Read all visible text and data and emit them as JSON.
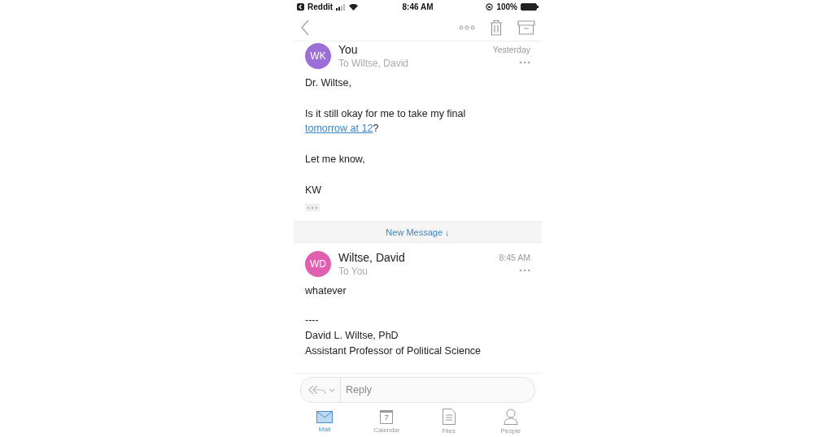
{
  "status_bar": {
    "back_app": "Reddit",
    "time": "8:46 AM",
    "battery": "100%"
  },
  "messages": [
    {
      "initials": "WK",
      "color": "#9b6fd6",
      "sender": "You",
      "recipients": "To Wiltse, David",
      "time": "Yesterday",
      "collapsed_quote": true,
      "body": [
        [
          {
            "text": "Dr. Wiltse,"
          }
        ],
        [
          {
            "text": "Is it still okay for me to take my final "
          },
          {
            "text": "tomorrow at 12",
            "kind": "link"
          },
          {
            "text": "?"
          }
        ],
        [
          {
            "text": "Let me know,"
          }
        ],
        [
          {
            "text": "KW"
          }
        ]
      ]
    },
    {
      "initials": "WD",
      "color": "#e25fb0",
      "sender": "Wiltse, David",
      "recipients": "To You",
      "time": "8:45 AM",
      "body": [
        [
          {
            "text": "whatever"
          }
        ]
      ],
      "signature": [
        "----",
        "David L. Wiltse, PhD",
        "Assistant Professor of Political Science"
      ]
    }
  ],
  "new_message_bar": "New Message ↓",
  "reply": {
    "placeholder": "Reply"
  },
  "tabs": [
    {
      "label": "Mail",
      "kind": "mail",
      "selected": true
    },
    {
      "label": "Calendar",
      "kind": "calendar",
      "selected": false,
      "day": "7"
    },
    {
      "label": "Files",
      "kind": "files",
      "selected": false
    },
    {
      "label": "People",
      "kind": "people",
      "selected": false
    }
  ]
}
